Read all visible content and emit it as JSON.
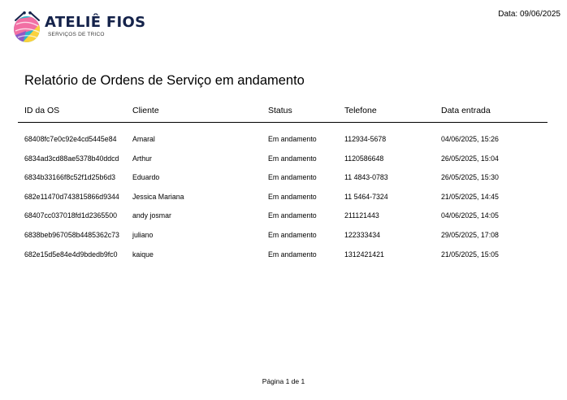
{
  "brand": {
    "name": "ATELIÊ FIOS",
    "tagline": "SERVIÇOS DE TRICO",
    "colors": [
      "#f26fa4",
      "#fbd23c",
      "#2fb5c8",
      "#8d5ac6",
      "#14224a"
    ],
    "logo_icon": "yarn-ball-icon"
  },
  "header": {
    "date_text": "Data: 09/06/2025"
  },
  "report": {
    "title": "Relatório de Ordens de Serviço em andamento",
    "columns": [
      "ID da OS",
      "Cliente",
      "Status",
      "Telefone",
      "Data entrada"
    ],
    "rows": [
      [
        "68408fc7e0c92e4cd5445e84",
        "Amaral",
        "Em andamento",
        "112934-5678",
        "04/06/2025, 15:26"
      ],
      [
        "6834ad3cd88ae5378b40ddcd",
        "Arthur",
        "Em andamento",
        "1120586648",
        "26/05/2025, 15:04"
      ],
      [
        "6834b33166f8c52f1d25b6d3",
        "Eduardo",
        "Em andamento",
        "11 4843-0783",
        "26/05/2025, 15:30"
      ],
      [
        "682e11470d743815866d9344",
        "Jessica Mariana",
        "Em andamento",
        "11 5464-7324",
        "21/05/2025, 14:45"
      ],
      [
        "68407cc037018fd1d2365500",
        "andy josmar",
        "Em andamento",
        "211121443",
        "04/06/2025, 14:05"
      ],
      [
        "6838beb967058b4485362c73",
        "juliano",
        "Em andamento",
        "122333434",
        "29/05/2025, 17:08"
      ],
      [
        "682e15d5e84e4d9bdedb9fc0",
        "kaique",
        "Em andamento",
        "1312421421",
        "21/05/2025, 15:05"
      ]
    ]
  },
  "footer": {
    "page_text": "Página 1 de 1"
  }
}
